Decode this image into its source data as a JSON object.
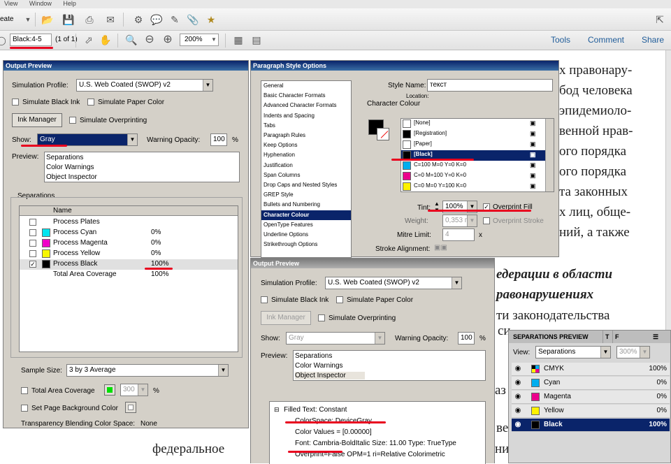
{
  "acrobat": {
    "menu": [
      "View",
      "Window",
      "Help"
    ],
    "create_label": "eate",
    "page_field": "Black:4-5",
    "page_count": "(1 of 1)",
    "zoom": "200%",
    "right_links": [
      "Tools",
      "Comment",
      "Share"
    ]
  },
  "document": {
    "lines": [
      "х правонару-",
      "бод человека",
      "эпидемиоло-",
      "венной нрав-",
      "ого порядка",
      "ого порядка",
      "та законных",
      "х лиц, обще-",
      "ний, а также"
    ],
    "bold_lines": [
      "едерации в области",
      "равонарушениях"
    ],
    "lower_lines": [
      "ти законодательства",
      "си",
      "аз",
      "ве"
    ],
    "bottom_left": "федеральное",
    "bottom_right": "ни"
  },
  "output_preview_1": {
    "title": "Output Preview",
    "simulation_profile_label": "Simulation Profile:",
    "simulation_profile": "U.S. Web Coated (SWOP) v2",
    "simulate_black_ink": "Simulate Black Ink",
    "simulate_paper_color": "Simulate Paper Color",
    "ink_manager": "Ink Manager",
    "simulate_overprinting": "Simulate Overprinting",
    "show_label": "Show:",
    "show_value": "Gray",
    "warning_opacity_label": "Warning Opacity:",
    "warning_opacity": "100",
    "percent": "%",
    "preview_label": "Preview:",
    "preview_items": [
      "Separations",
      "Color Warnings",
      "Object Inspector"
    ],
    "separations_label": "Separations",
    "name_header": "Name",
    "separations": [
      {
        "name": "Process Plates",
        "value": "",
        "color": "",
        "checked": false
      },
      {
        "name": "Process Cyan",
        "value": "0%",
        "color": "#00e5f0",
        "checked": false
      },
      {
        "name": "Process Magenta",
        "value": "0%",
        "color": "#f000c8",
        "checked": false
      },
      {
        "name": "Process Yellow",
        "value": "0%",
        "color": "#f7f700",
        "checked": false
      },
      {
        "name": "Process Black",
        "value": "100%",
        "color": "#000000",
        "checked": true
      },
      {
        "name": "Total Area Coverage",
        "value": "100%",
        "color": "",
        "checked": false
      }
    ],
    "sample_size_label": "Sample Size:",
    "sample_size": "3 by 3 Average",
    "total_area_coverage": "Total Area Coverage",
    "tac_value": "300",
    "set_page_bg": "Set Page Background Color",
    "transparency_label": "Transparency Blending Color Space:",
    "transparency_value": "None"
  },
  "paragraph_style": {
    "title": "Paragraph Style Options",
    "categories": [
      "General",
      "Basic Character Formats",
      "Advanced Character Formats",
      "Indents and Spacing",
      "Tabs",
      "Paragraph Rules",
      "Keep Options",
      "Hyphenation",
      "Justification",
      "Span Columns",
      "Drop Caps and Nested Styles",
      "GREP Style",
      "Bullets and Numbering",
      "Character Colour",
      "OpenType Features",
      "Underline Options",
      "Strikethrough Options"
    ],
    "selected_category": "Character Colour",
    "style_name_label": "Style Name:",
    "style_name": "текст",
    "location_label": "Location:",
    "section_title": "Character Colour",
    "swatches": [
      {
        "name": "[None]",
        "color": "#ffffff"
      },
      {
        "name": "[Registration]",
        "color": "#000000"
      },
      {
        "name": "[Paper]",
        "color": "#ffffff"
      },
      {
        "name": "[Black]",
        "color": "#000000"
      },
      {
        "name": "C=100 M=0 Y=0 K=0",
        "color": "#00aeef"
      },
      {
        "name": "C=0 M=100 Y=0 K=0",
        "color": "#ec008c"
      },
      {
        "name": "C=0 M=0 Y=100 K=0",
        "color": "#fff200"
      }
    ],
    "tint_label": "Tint:",
    "tint": "100%",
    "overprint_fill": "Overprint Fill",
    "weight_label": "Weight:",
    "weight": "0,353 п",
    "overprint_stroke": "Overprint Stroke",
    "mitre_label": "Mitre Limit:",
    "mitre": "4",
    "mitre_x": "x",
    "stroke_alignment_label": "Stroke Alignment:"
  },
  "output_preview_2": {
    "title": "Output Preview",
    "simulation_profile_label": "Simulation Profile:",
    "simulation_profile": "U.S. Web Coated (SWOP) v2",
    "simulate_black_ink": "Simulate Black Ink",
    "simulate_paper_color": "Simulate Paper Color",
    "ink_manager": "Ink Manager",
    "simulate_overprinting": "Simulate Overprinting",
    "show_label": "Show:",
    "show_value": "Gray",
    "warning_opacity_label": "Warning Opacity:",
    "warning_opacity": "100",
    "percent": "%",
    "preview_label": "Preview:",
    "preview_items": [
      "Separations",
      "Color Warnings",
      "Object Inspector"
    ],
    "inspector_root": "Filled Text: Constant",
    "inspector_lines": [
      "ColorSpace: DeviceGray",
      "Color Values = [0.00000]",
      "Font: Cambria-BoldItalic Size: 11.00 Type: TrueType",
      "Overprint=False OPM=1 ri=Relative Colorimetric"
    ]
  },
  "sep_preview": {
    "tab1": "SEPARATIONS PREVIEW",
    "tab2": "T",
    "tab3": "F",
    "view_label": "View:",
    "view_value": "Separations",
    "zoom": "300%",
    "inks": [
      {
        "name": "CMYK",
        "value": "100%",
        "color": "cmyk"
      },
      {
        "name": "Cyan",
        "value": "0%",
        "color": "#00aeef"
      },
      {
        "name": "Magenta",
        "value": "0%",
        "color": "#ec008c"
      },
      {
        "name": "Yellow",
        "value": "0%",
        "color": "#fff200"
      },
      {
        "name": "Black",
        "value": "100%",
        "color": "#000000"
      }
    ]
  }
}
